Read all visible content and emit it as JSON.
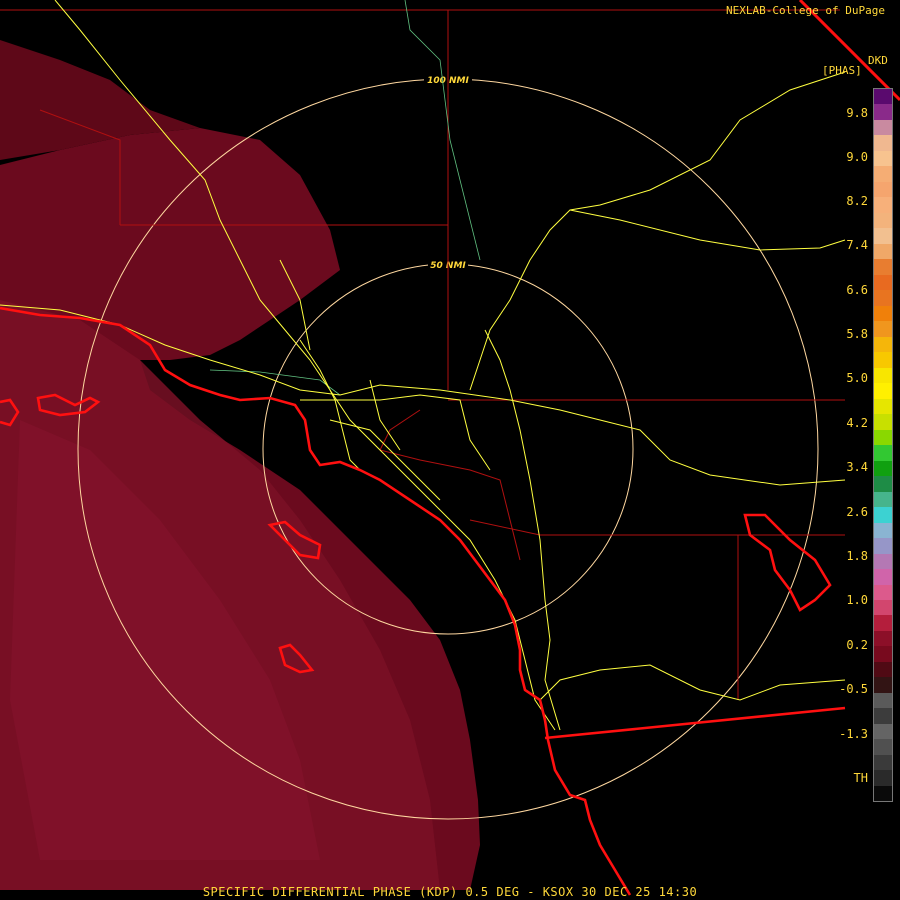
{
  "credit": "NEXLAB-College of DuPage",
  "product_code": "DKD",
  "units": "[PHAS]",
  "footer": "SPECIFIC DIFFERENTIAL PHASE (KDP) 0.5 DEG - KSOX 30 DEC 25 14:30",
  "range_rings": {
    "outer_label": "100 NMI",
    "inner_label": "50 NMI"
  },
  "color_scale": {
    "labels": [
      "9.8",
      "9.0",
      "8.2",
      "7.4",
      "6.6",
      "5.8",
      "5.0",
      "4.2",
      "3.4",
      "2.6",
      "1.8",
      "1.0",
      "0.2",
      "-0.5",
      "-1.3",
      "TH"
    ],
    "swatches": [
      "#5a0a6e",
      "#8a2a8a",
      "#c98aa0",
      "#f0b890",
      "#f7c38f",
      "#f5ad74",
      "#f5a56e",
      "#f7b07a",
      "#f3b37c",
      "#f2c090",
      "#f0a868",
      "#e87d30",
      "#e86a20",
      "#e87420",
      "#f0800a",
      "#f0961e",
      "#f5b60a",
      "#f8c800",
      "#f8e600",
      "#fff000",
      "#e6e600",
      "#c8e000",
      "#8ad800",
      "#32c832",
      "#10a010",
      "#1e8c46",
      "#46b48c",
      "#3cd2d2",
      "#8ab4d2",
      "#9696c8",
      "#b478b4",
      "#d064aa",
      "#dc5a8c",
      "#d2466e",
      "#b41e3c",
      "#8c0f28",
      "#780a1e",
      "#500a14",
      "#321414",
      "#5a5a5a",
      "#3c3c3c",
      "#646464",
      "#505050",
      "#3a3a3a",
      "#2a2a2a",
      "#0a0a0a"
    ]
  },
  "colors": {
    "echo": "#6e0a1e",
    "echo_light": "#7e1026",
    "coast": "#ff1010",
    "county_border": "#b01010",
    "road": "#ffff40",
    "ring": "#ffd8a0",
    "river": "#60c080"
  }
}
